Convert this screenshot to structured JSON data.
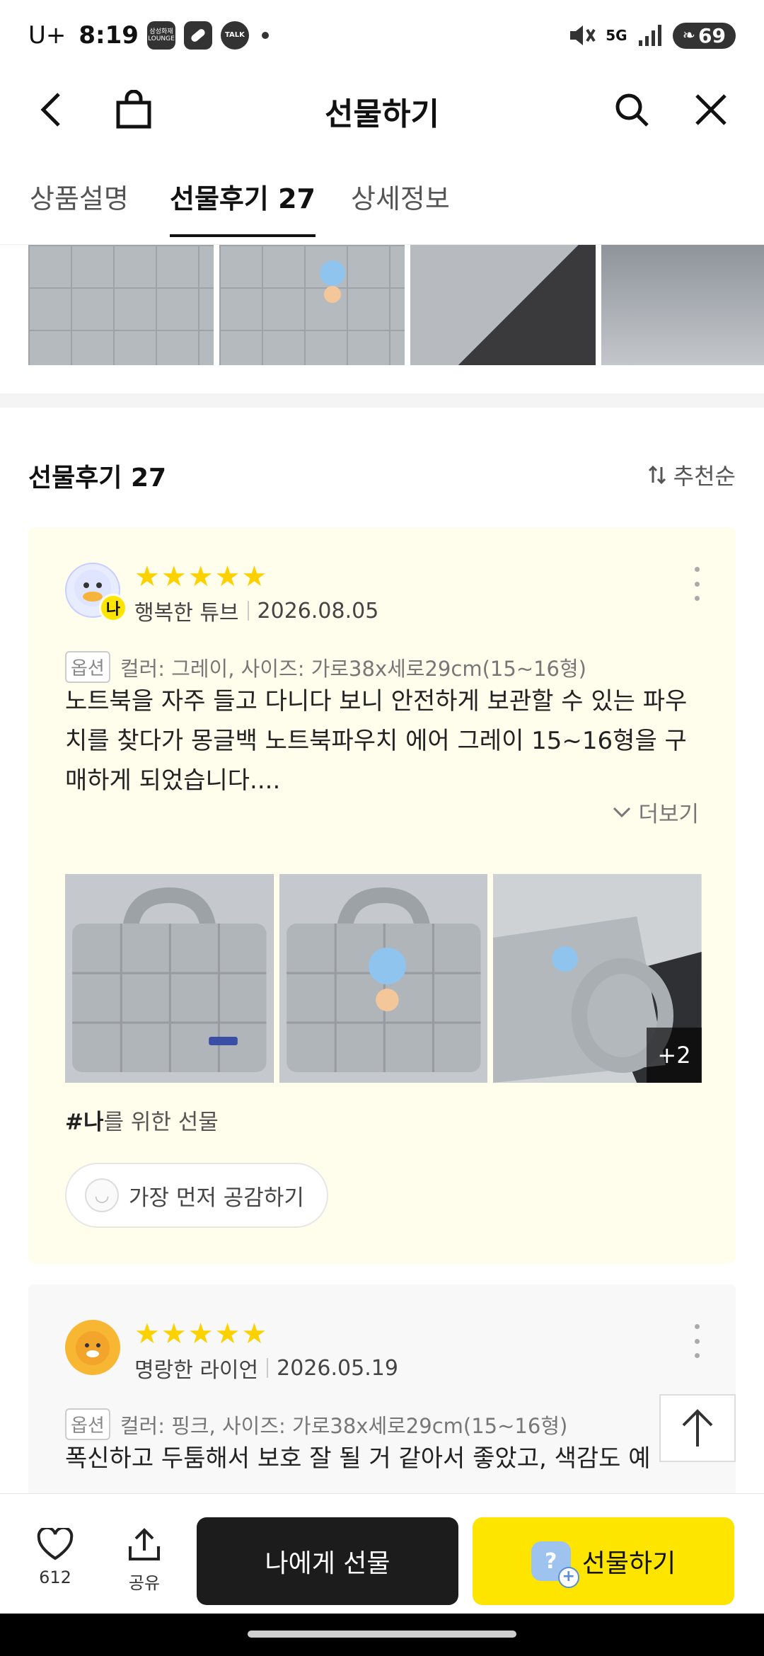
{
  "status_bar": {
    "carrier": "U+",
    "time": "8:19",
    "battery": "69",
    "network": "5G",
    "notif_icons": [
      "samsung-wallet-lounge-icon",
      "pill-icon",
      "kakaotalk-icon"
    ],
    "notif_badges": {
      "lounge": "삼성화재 LOUNGE",
      "talk": "TALK"
    }
  },
  "header": {
    "title": "선물하기"
  },
  "tabs": [
    {
      "label": "상품설명"
    },
    {
      "label": "선물후기 27"
    },
    {
      "label": "상세정보"
    }
  ],
  "section": {
    "title": "선물후기 27",
    "sort_label": "추천순"
  },
  "reviews": [
    {
      "nickname": "행복한 튜브",
      "date": "2026.08.05",
      "rating": 5,
      "me_badge": "나",
      "option_tag": "옵션",
      "option": "컬러: 그레이, 사이즈: 가로38x세로29cm(15~16형)",
      "text": "노트북을 자주 들고 다니다 보니 안전하게 보관할 수 있는 파우치를 찾다가 몽글백 노트북파우치 에어 그레이 15~16형을 구매하게 되었습니다....",
      "more_label": "더보기",
      "photo_more": "+2",
      "hashtag_prefix": "#나",
      "hashtag_suffix": "를 위한 선물",
      "empathy_label": "가장 먼저 공감하기"
    },
    {
      "nickname": "명랑한 라이언",
      "date": "2026.05.19",
      "rating": 5,
      "option_tag": "옵션",
      "option": "컬러: 핑크, 사이즈: 가로38x세로29cm(15~16형)",
      "text": "폭신하고 두툼해서 보호 잘 될 거 같아서 좋았고, 색감도 예"
    }
  ],
  "bottom_bar": {
    "like_count": "612",
    "share_label": "공유",
    "gift_to_me": "나에게 선물",
    "gift": "선물하기"
  },
  "colors": {
    "accent_yellow": "#fee500",
    "star": "#fcd100",
    "card_bg": "#fffdeb"
  }
}
